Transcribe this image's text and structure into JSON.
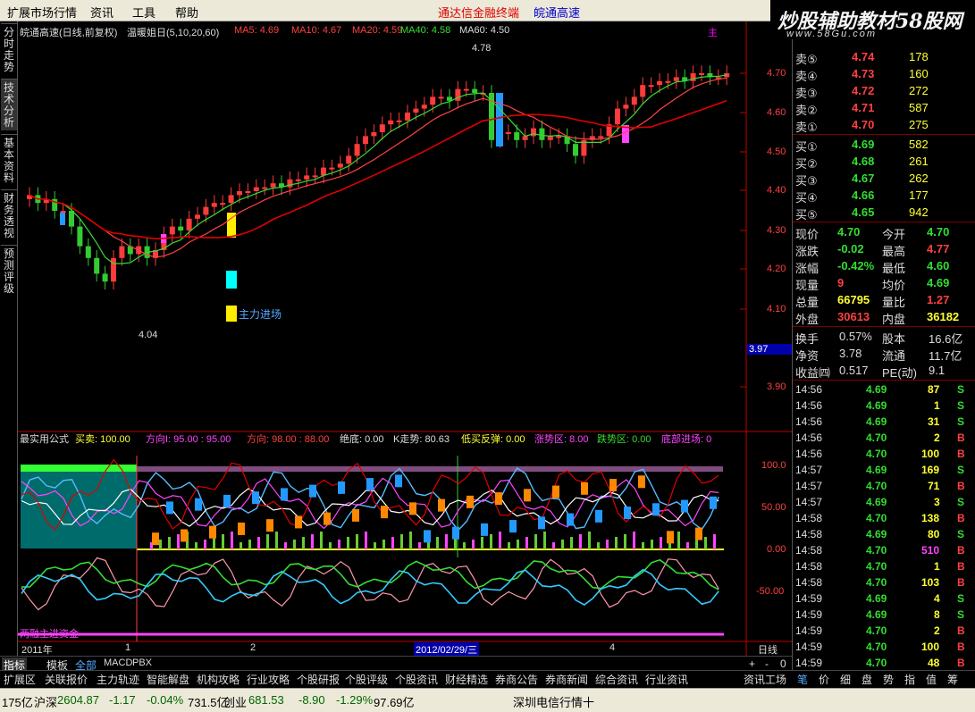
{
  "menu": [
    "扩展市场行情",
    "资讯",
    "工具",
    "帮助"
  ],
  "ads": {
    "a1": "通达信金融终端",
    "a2": "皖通高速"
  },
  "logo": {
    "main": "炒股辅助教材58股网",
    "sub": "www.58Gu.com"
  },
  "left_tabs": [
    "分时走势",
    "技术分析",
    "基本资料",
    "财务透视",
    "预测评级"
  ],
  "chart_header": {
    "title": "皖通高速(日线,前复权)",
    "indicator": "温暖姐日(5,10,20,60)",
    "ma5": "MA5: 4.69",
    "ma10": "MA10: 4.67",
    "ma20": "MA20: 4.59",
    "ma40": "MA40: 4.58",
    "ma60": "MA60: 4.50",
    "right_mark": "主",
    "colors": {
      "up": "#ff3b3b",
      "down": "#33cc33",
      "ma_red": "#e00000",
      "ma_green": "#33cc33",
      "axis": "#c00000"
    }
  },
  "price_axis": [
    "4.70",
    "4.60",
    "4.50",
    "4.40",
    "4.30",
    "4.20",
    "4.10",
    "3.97",
    "3.90"
  ],
  "annotations": {
    "high": "4.78",
    "low": "4.04",
    "signal": "主力进场"
  },
  "sub_header": {
    "name": "最实用公式",
    "buy": "买卖: 100.00",
    "dir1": "方向I: 95.00 : 95.00",
    "dir2": "方向: 98.00 : 88.00",
    "bottom": "绝底: 0.00",
    "k": "K走势: 80.63",
    "low_buy": "低买反弹: 0.00",
    "rise": "涨势区: 8.00",
    "fall": "跌势区: 0.00",
    "bottom_in": "底部进场: 0"
  },
  "sub_axis": [
    "100.0",
    "50.00",
    "0.00",
    "-50.00"
  ],
  "sub_label": "两融主进资金",
  "time_axis": {
    "year": "2011年",
    "m1": "1",
    "m2": "2",
    "date": "2012/02/29/三",
    "m4": "4",
    "period": "日线"
  },
  "quote": {
    "sell": [
      {
        "label": "卖⑤",
        "price": "4.74",
        "vol": "178"
      },
      {
        "label": "卖④",
        "price": "4.73",
        "vol": "160"
      },
      {
        "label": "卖③",
        "price": "4.72",
        "vol": "272"
      },
      {
        "label": "卖②",
        "price": "4.71",
        "vol": "587"
      },
      {
        "label": "卖①",
        "price": "4.70",
        "vol": "275"
      }
    ],
    "buy": [
      {
        "label": "买①",
        "price": "4.69",
        "vol": "582"
      },
      {
        "label": "买②",
        "price": "4.68",
        "vol": "261"
      },
      {
        "label": "买③",
        "price": "4.67",
        "vol": "262"
      },
      {
        "label": "买④",
        "price": "4.66",
        "vol": "177"
      },
      {
        "label": "买⑤",
        "price": "4.65",
        "vol": "942"
      }
    ],
    "stats": [
      {
        "l1": "现价",
        "v1": "4.70",
        "l2": "今开",
        "v2": "4.70"
      },
      {
        "l1": "涨跌",
        "v1": "-0.02",
        "l2": "最高",
        "v2": "4.77"
      },
      {
        "l1": "涨幅",
        "v1": "-0.42%",
        "l2": "最低",
        "v2": "4.60"
      },
      {
        "l1": "现量",
        "v1": "9",
        "l2": "均价",
        "v2": "4.69"
      },
      {
        "l1": "总量",
        "v1": "66795",
        "l2": "量比",
        "v2": "1.27"
      },
      {
        "l1": "外盘",
        "v1": "30613",
        "l2": "内盘",
        "v2": "36182"
      }
    ],
    "fund": [
      {
        "l1": "换手",
        "v1": "0.57%",
        "l2": "股本",
        "v2": "16.6亿"
      },
      {
        "l1": "净资",
        "v1": "3.78",
        "l2": "流通",
        "v2": "11.7亿"
      },
      {
        "l1": "收益㈣",
        "v1": "0.517",
        "l2": "PE(动)",
        "v2": "9.1"
      }
    ]
  },
  "ticks": [
    {
      "t": "14:56",
      "p": "4.69",
      "v": "87",
      "s": "S"
    },
    {
      "t": "14:56",
      "p": "4.69",
      "v": "1",
      "s": "S"
    },
    {
      "t": "14:56",
      "p": "4.69",
      "v": "31",
      "s": "S"
    },
    {
      "t": "14:56",
      "p": "4.70",
      "v": "2",
      "s": "B"
    },
    {
      "t": "14:56",
      "p": "4.70",
      "v": "100",
      "s": "B"
    },
    {
      "t": "14:57",
      "p": "4.69",
      "v": "169",
      "s": "S"
    },
    {
      "t": "14:57",
      "p": "4.70",
      "v": "71",
      "s": "B"
    },
    {
      "t": "14:57",
      "p": "4.69",
      "v": "3",
      "s": "S"
    },
    {
      "t": "14:58",
      "p": "4.70",
      "v": "138",
      "s": "B"
    },
    {
      "t": "14:58",
      "p": "4.69",
      "v": "80",
      "s": "S"
    },
    {
      "t": "14:58",
      "p": "4.70",
      "v": "510",
      "s": "B"
    },
    {
      "t": "14:58",
      "p": "4.70",
      "v": "1",
      "s": "B"
    },
    {
      "t": "14:58",
      "p": "4.70",
      "v": "103",
      "s": "B"
    },
    {
      "t": "14:59",
      "p": "4.69",
      "v": "4",
      "s": "S"
    },
    {
      "t": "14:59",
      "p": "4.69",
      "v": "8",
      "s": "S"
    },
    {
      "t": "14:59",
      "p": "4.70",
      "v": "2",
      "s": "B"
    },
    {
      "t": "14:59",
      "p": "4.70",
      "v": "100",
      "s": "B"
    },
    {
      "t": "14:59",
      "p": "4.70",
      "v": "48",
      "s": "B"
    }
  ],
  "bottom_tabs1": [
    "指标",
    "模板",
    "全部",
    "MACD",
    "PBX"
  ],
  "bottom_tabs2": [
    "扩展区",
    "关联报价",
    "主力轨迹",
    "智能解盘",
    "机构攻略",
    "行业攻略",
    "个股研报",
    "个股评级",
    "个股资讯",
    "财经精选",
    "券商公告",
    "券商新闻",
    "综合资讯",
    "行业资讯",
    "资讯工场"
  ],
  "right_tabs": [
    "笔",
    "价",
    "细",
    "盘",
    "势",
    "指",
    "值",
    "筹"
  ],
  "status": {
    "s0": "175亿",
    "hs": "沪深",
    "hs_val": "2604.87",
    "hs_chg": "-1.17",
    "hs_pct": "-0.04%",
    "hs_amt": "731.5亿",
    "cy": "创业",
    "cy_val": "681.53",
    "cy_chg": "-8.90",
    "cy_pct": "-1.29%",
    "cy_amt": "97.69亿",
    "feed": "深圳电信行情十"
  }
}
